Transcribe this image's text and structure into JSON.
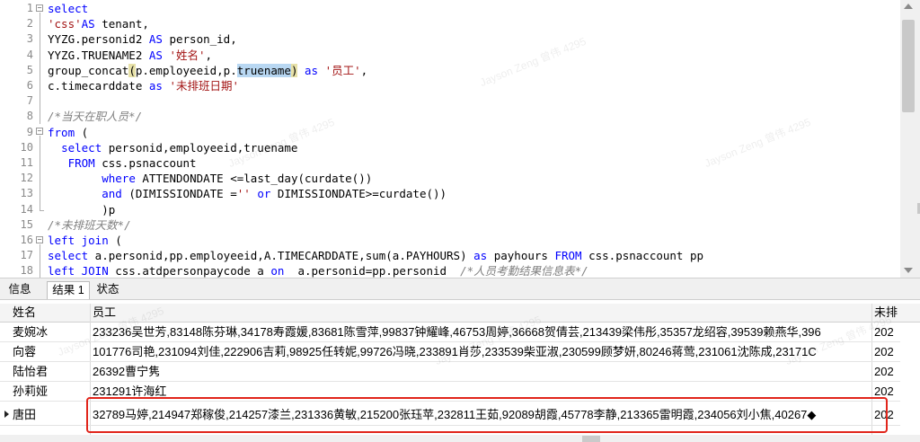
{
  "editor": {
    "line_numbers": [
      "1",
      "2",
      "3",
      "4",
      "5",
      "6",
      "7",
      "8",
      "9",
      "10",
      "11",
      "12",
      "13",
      "14",
      "15",
      "16",
      "17",
      "18"
    ]
  },
  "tabs": [
    {
      "label": "信息"
    },
    {
      "label": "结果 1"
    },
    {
      "label": "状态"
    }
  ],
  "grid": {
    "columns": [
      "姓名",
      "员工",
      "未排"
    ],
    "rows": [
      {
        "name": "麦婉冰",
        "employees": "233236吴世芳,83148陈芬琳,34178寿霞媛,83681陈雪萍,99837钟耀峰,46753周婷,36668贺倩芸,213439梁伟彤,35357龙绍容,39539赖燕华,396",
        "date": "202"
      },
      {
        "name": "向蓉",
        "employees": "101776司艳,231094刘佳,222906吉莉,98925任转妮,99726冯晓,233891肖莎,233539柴亚淑,230599顾梦妍,80246蒋莺,231061沈陈成,23171C",
        "date": "202"
      },
      {
        "name": "陆怡君",
        "employees": "26392曹宁隽",
        "date": "202"
      },
      {
        "name": "孙莉娅",
        "employees": "231291许海红",
        "date": "202"
      },
      {
        "name": "唐田",
        "employees": "32789马婷,214947郑稼俊,214257漆兰,231336黄敏,215200张珏苹,232811王茹,92089胡霞,45778李静,213365雷明霞,234056刘小焦,40267◆",
        "date": "202"
      }
    ]
  },
  "watermark": {
    "text": "Jayson Zeng 曾伟 4295"
  }
}
